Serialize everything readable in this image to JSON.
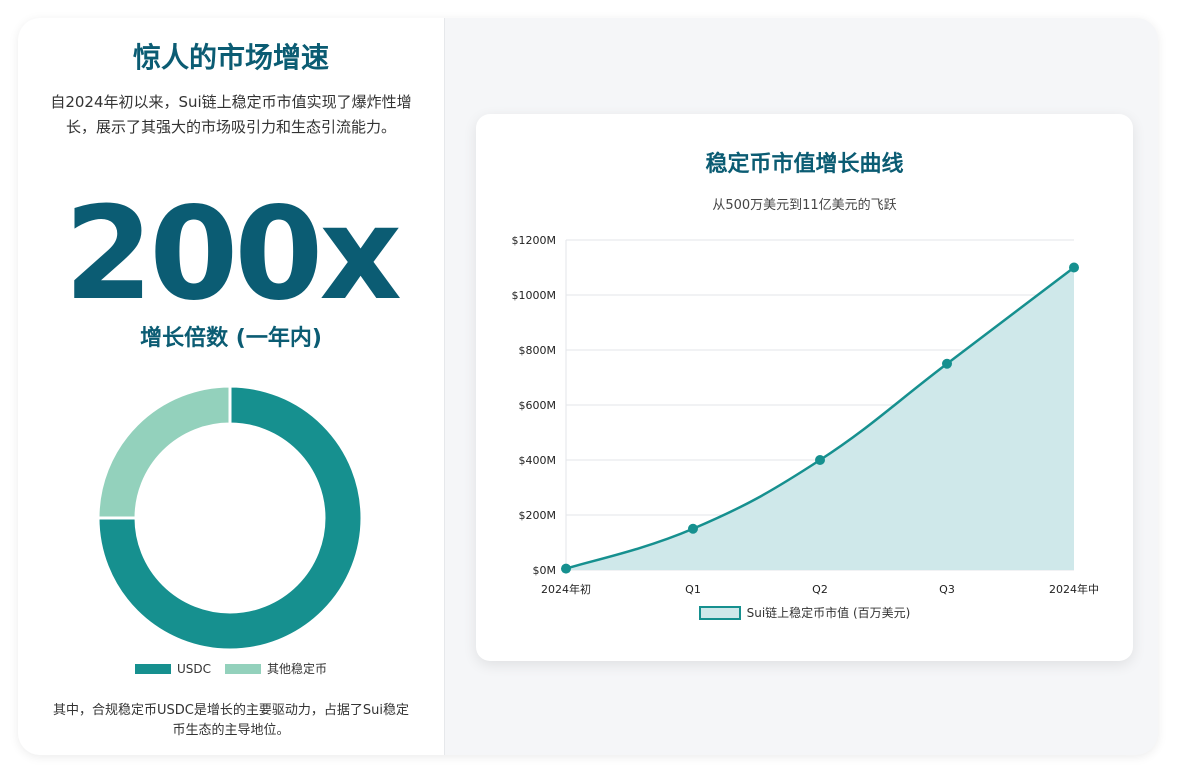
{
  "left": {
    "title": "惊人的市场增速",
    "description": "自2024年初以来，Sui链上稳定币市值实现了爆炸性增长，展示了其强大的市场吸引力和生态引流能力。",
    "big_number": "200x",
    "big_label": "增长倍数 (一年内)",
    "note": "其中，合规稳定币USDC是增长的主要驱动力，占据了Sui稳定币生态的主导地位。"
  },
  "chart_data": [
    {
      "type": "pie",
      "labels": [
        "USDC",
        "其他稳定币"
      ],
      "values": [
        75,
        25
      ],
      "colors": [
        "#16908f",
        "#93d1bc"
      ]
    },
    {
      "type": "area",
      "title": "稳定币市值增长曲线",
      "subtitle": "从500万美元到11亿美元的飞跃",
      "categories": [
        "2024年初",
        "Q1",
        "Q2",
        "Q3",
        "2024年中"
      ],
      "series": [
        {
          "name": "Sui链上稳定币市值 (百万美元)",
          "values": [
            5,
            150,
            400,
            750,
            1100
          ]
        }
      ],
      "yticks": [
        "$0M",
        "$200M",
        "$400M",
        "$600M",
        "$800M",
        "$1000M",
        "$1200M"
      ],
      "ylim": [
        0,
        1200
      ],
      "grid": true,
      "legend": "bottom",
      "line_color": "#16908f",
      "fill_color": "#cfe8ea"
    }
  ]
}
